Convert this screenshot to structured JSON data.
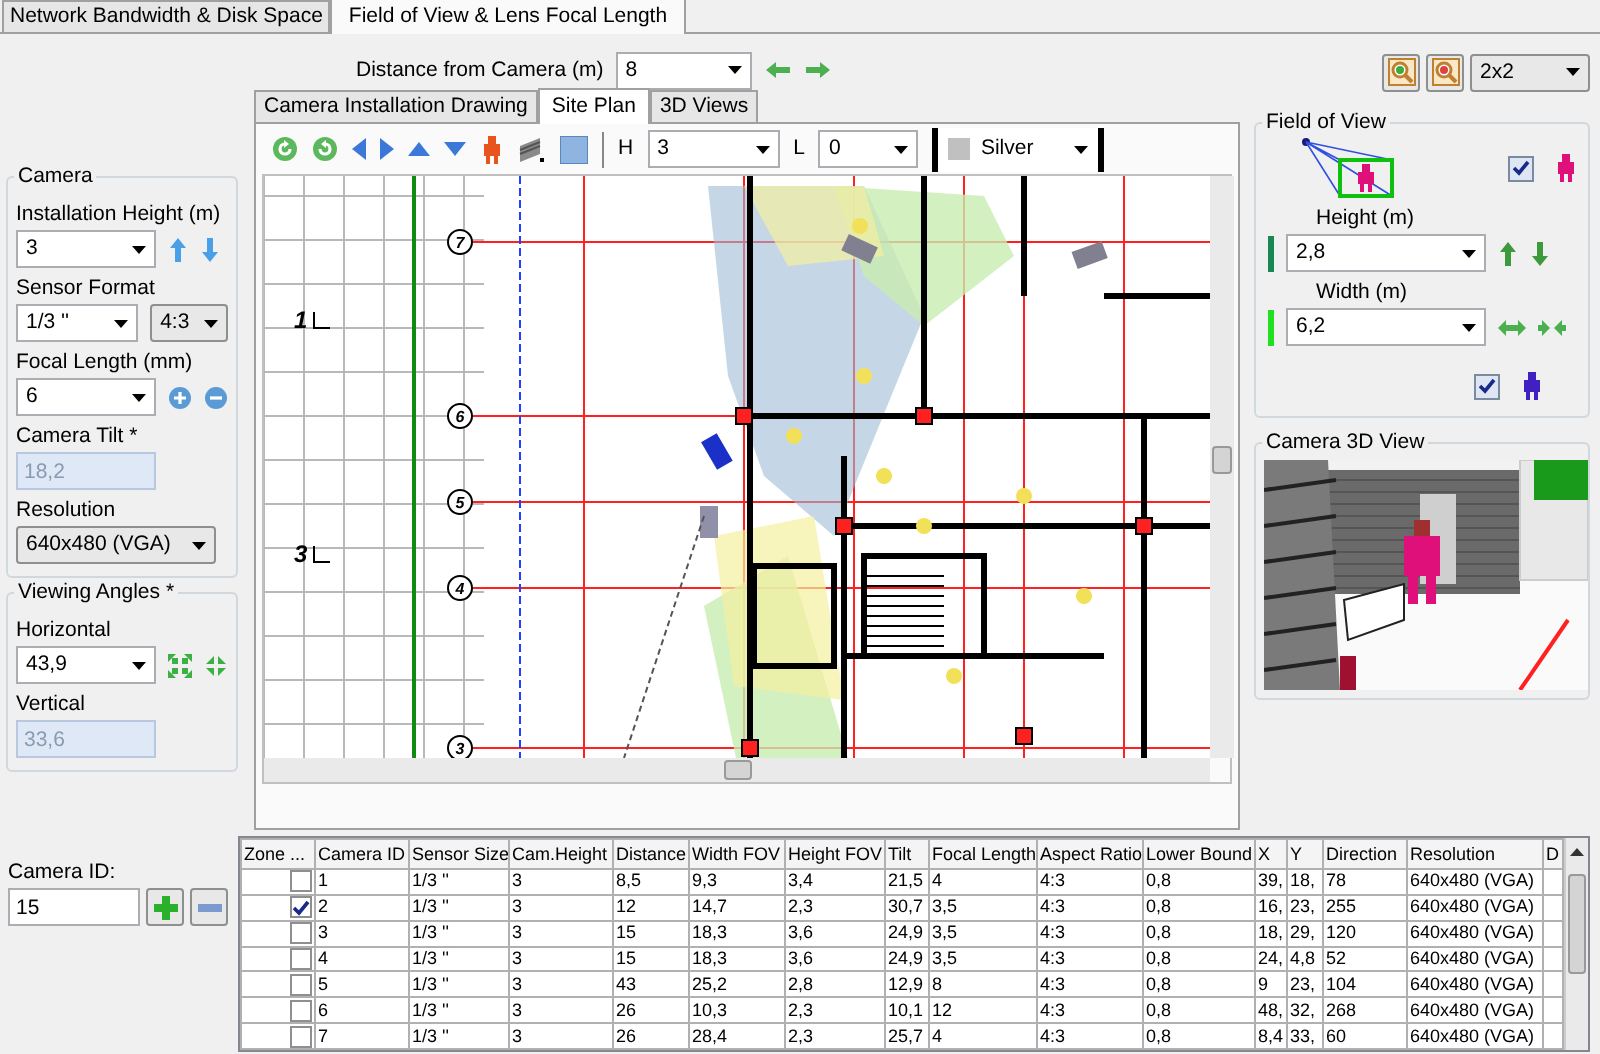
{
  "tabs": [
    {
      "label": "Network Bandwidth & Disk Space",
      "selected": false
    },
    {
      "label": "Field of View & Lens Focal Length",
      "selected": true
    }
  ],
  "distance": {
    "label": "Distance from Camera  (m)",
    "value": "8"
  },
  "layout_select": {
    "value": "2x2"
  },
  "camera": {
    "title": "Camera",
    "installation_height": {
      "label": "Installation Height (m)",
      "value": "3"
    },
    "sensor_format": {
      "label": "Sensor Format",
      "value": "1/3 ''",
      "aspect": "4:3"
    },
    "focal_length": {
      "label": "Focal Length (mm)",
      "value": "6"
    },
    "camera_tilt": {
      "label": "Camera Tilt *",
      "value": "18,2",
      "disabled": true
    },
    "resolution": {
      "label": "Resolution",
      "value": "640x480 (VGA)"
    }
  },
  "viewing_angles": {
    "title": "Viewing Angles *",
    "horizontal": {
      "label": "Horizontal",
      "value": "43,9",
      "disabled": false
    },
    "vertical": {
      "label": "Vertical",
      "value": "33,6",
      "disabled": true
    }
  },
  "plan_tabs": [
    {
      "label": "Camera Installation Drawing",
      "selected": false
    },
    {
      "label": "Site Plan",
      "selected": true
    },
    {
      "label": "3D Views",
      "selected": false
    }
  ],
  "plan_toolbar": {
    "h_label": "H",
    "h_value": "3",
    "l_label": "L",
    "l_value": "0",
    "color_value": "Silver"
  },
  "plan": {
    "grid_labels": [
      "7",
      "6",
      "5",
      "4",
      "3"
    ],
    "floor_labels": [
      "1",
      "3"
    ]
  },
  "field_of_view": {
    "title": "Field of View",
    "target_visible": true,
    "height": {
      "label": "Height (m)",
      "value": "2,8"
    },
    "width": {
      "label": "Width (m)",
      "value": "6,2"
    },
    "person_visible": true
  },
  "camera_3d_view": {
    "title": "Camera 3D View"
  },
  "camera_id": {
    "label": "Camera ID:",
    "value": "15"
  },
  "table": {
    "columns": [
      "Zone ...",
      "Camera ID",
      "Sensor Size",
      "Cam.Height",
      "Distance",
      "Width FOV",
      "Height FOV",
      "Tilt",
      "Focal Length",
      "Aspect Ratio",
      "Lower Bound",
      "X",
      "Y",
      "Direction",
      "Resolution",
      "D"
    ],
    "rows": [
      {
        "zone": false,
        "cells": [
          "",
          "1",
          "1/3 ''",
          "3",
          "8,5",
          "9,3",
          "3,4",
          "21,5",
          "4",
          "4:3",
          "0,8",
          "39,",
          "18,",
          "78",
          "640x480 (VGA)",
          ""
        ]
      },
      {
        "zone": true,
        "cells": [
          "",
          "2",
          "1/3 ''",
          "3",
          "12",
          "14,7",
          "2,3",
          "30,7",
          "3,5",
          "4:3",
          "0,8",
          "16,",
          "23,",
          "255",
          "640x480 (VGA)",
          ""
        ]
      },
      {
        "zone": false,
        "cells": [
          "",
          "3",
          "1/3 ''",
          "3",
          "15",
          "18,3",
          "3,6",
          "24,9",
          "3,5",
          "4:3",
          "0,8",
          "18,",
          "29,",
          "120",
          "640x480 (VGA)",
          ""
        ]
      },
      {
        "zone": false,
        "cells": [
          "",
          "4",
          "1/3 ''",
          "3",
          "15",
          "18,3",
          "3,6",
          "24,9",
          "3,5",
          "4:3",
          "0,8",
          "24,",
          "4,8",
          "52",
          "640x480 (VGA)",
          ""
        ]
      },
      {
        "zone": false,
        "cells": [
          "",
          "5",
          "1/3 ''",
          "3",
          "43",
          "25,2",
          "2,8",
          "12,9",
          "8",
          "4:3",
          "0,8",
          "9",
          "23,",
          "104",
          "640x480 (VGA)",
          ""
        ]
      },
      {
        "zone": false,
        "cells": [
          "",
          "6",
          "1/3 ''",
          "3",
          "26",
          "10,3",
          "2,3",
          "10,1",
          "12",
          "4:3",
          "0,8",
          "48,",
          "32,",
          "268",
          "640x480 (VGA)",
          ""
        ]
      },
      {
        "zone": false,
        "cells": [
          "",
          "7",
          "1/3 ''",
          "3",
          "26",
          "28,4",
          "2,3",
          "25,7",
          "4",
          "4:3",
          "0,8",
          "8,4",
          "33,",
          "60",
          "640x480 (VGA)",
          ""
        ]
      }
    ]
  }
}
